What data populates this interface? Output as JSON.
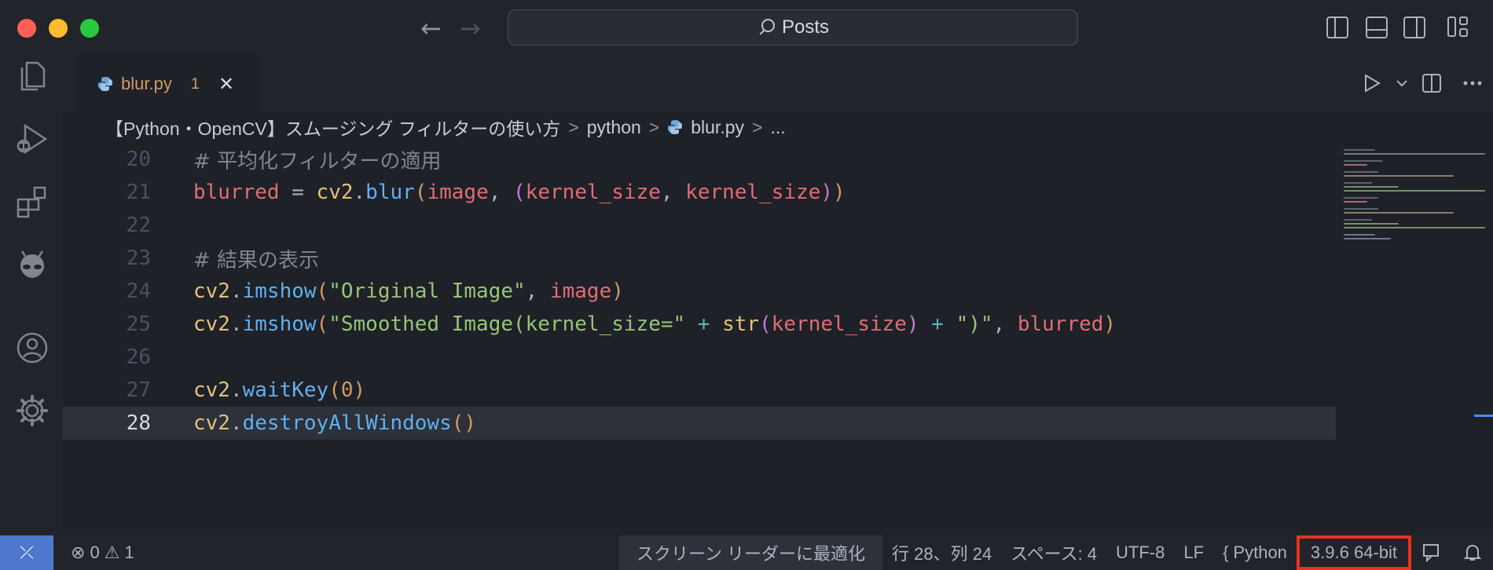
{
  "titlebar": {
    "search_label": "Posts",
    "back_arrow": "←",
    "forward_arrow": "→"
  },
  "tab": {
    "filename": "blur.py",
    "problem_count": "1",
    "close_glyph": "✕"
  },
  "breadcrumb": {
    "folder": "【Python・OpenCV】スムージング フィルターの使い方",
    "subfolder": "python",
    "file": "blur.py",
    "more": "...",
    "sep": ">"
  },
  "editor": {
    "line_numbers": [
      "20",
      "21",
      "22",
      "23",
      "24",
      "25",
      "26",
      "27",
      "28"
    ],
    "lines": {
      "l20": "# 平均化フィルターの適用",
      "l23": "# 結果の表示"
    },
    "tokens": {
      "blurred": "blurred",
      "eq": " = ",
      "cv2": "cv2",
      "dot": ".",
      "blur": "blur",
      "lparen": "(",
      "rparen": ")",
      "image": "image",
      "comma": ", ",
      "kernel_size": "kernel_size",
      "imshow": "imshow",
      "str_original": "\"Original Image\"",
      "str_smoothed": "\"Smoothed Image(kernel_size=\"",
      "plus": " + ",
      "str_fn": "str",
      "str_close": "\")\"",
      "waitKey": "waitKey",
      "zero": "0",
      "destroy": "destroyAllWindows",
      "empty_parens": "()"
    },
    "current_line": "28"
  },
  "statusbar": {
    "remote_glyph": "⤫",
    "errors": "0",
    "warnings": "1",
    "screen_reader": "スクリーン リーダーに最適化",
    "cursor": "行 28、列 24",
    "indent": "スペース: 4",
    "encoding": "UTF-8",
    "eol": "LF",
    "language": "Python",
    "interpreter": "3.9.6 64-bit"
  },
  "colors": {
    "accent": "#4d78cc",
    "highlight_box": "#e8321e",
    "tab_label": "#d19a66"
  }
}
